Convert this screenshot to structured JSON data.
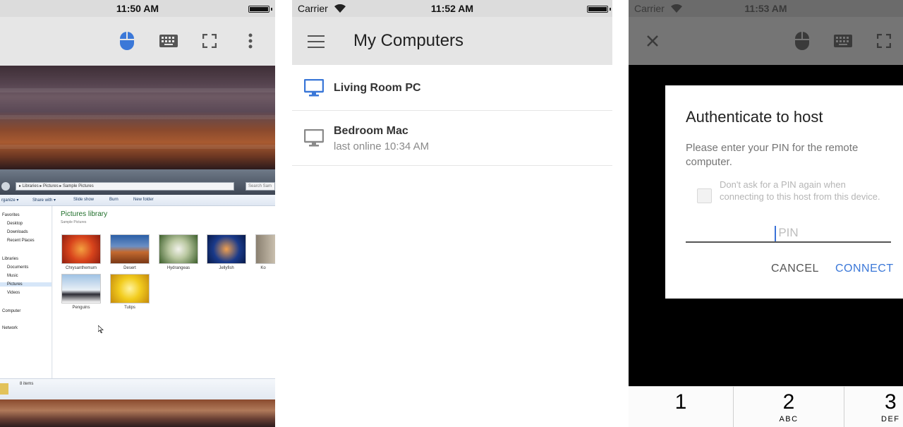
{
  "screen1": {
    "statusbar": {
      "time": "11:50 AM"
    },
    "toolbar": {
      "icons": [
        "mouse-icon",
        "keyboard-icon",
        "fullscreen-icon",
        "more-vert-icon"
      ]
    },
    "explorer": {
      "address_path": "▸ Libraries ▸ Pictures ▸ Sample Pictures",
      "search_placeholder": "Search Sam",
      "commands": [
        "rganize ▾",
        "Share with ▾",
        "Slide show",
        "Burn",
        "New folder"
      ],
      "nav": [
        "Favorites",
        "Desktop",
        "Downloads",
        "Recent Places",
        "Libraries",
        "Documents",
        "Music",
        "Pictures",
        "Videos",
        "Computer",
        "Network"
      ],
      "library_title": "Pictures library",
      "library_subtitle": "Sample Pictures",
      "thumbnails": [
        "Chrysanthemum",
        "Desert",
        "Hydrangeas",
        "Jellyfish",
        "Ko",
        "Penguins",
        "Tulips"
      ],
      "status_count": "8 items"
    }
  },
  "screen2": {
    "statusbar": {
      "carrier": "Carrier",
      "time": "11:52 AM"
    },
    "appbar": {
      "title": "My Computers",
      "menu_icon": "menu-icon"
    },
    "hosts": [
      {
        "name": "Living Room PC",
        "status": "",
        "online": true,
        "icon_color": "#3b78d8"
      },
      {
        "name": "Bedroom Mac",
        "status": "last online 10:34 AM",
        "online": false,
        "icon_color": "#8a8a8a"
      }
    ]
  },
  "screen3": {
    "statusbar": {
      "carrier": "Carrier",
      "time": "11:53 AM"
    },
    "toolbar": {
      "icons": [
        "close-icon",
        "mouse-icon",
        "keyboard-icon",
        "fullscreen-icon"
      ]
    },
    "dialog": {
      "title": "Authenticate to host",
      "message": "Please enter your PIN for the remote computer.",
      "checkbox_label": "Don't ask for a PIN again when connecting to this host from this device.",
      "pin_placeholder": "PIN",
      "pin_value": "",
      "cancel_label": "CANCEL",
      "connect_label": "CONNECT"
    },
    "keypad": [
      {
        "num": "1",
        "letters": ""
      },
      {
        "num": "2",
        "letters": "ABC"
      },
      {
        "num": "3",
        "letters": "DEF"
      }
    ]
  },
  "colors": {
    "accent_blue": "#3b78d8",
    "toolbar_gray": "#e6e6e6",
    "dim_toolbar": "#757575"
  }
}
